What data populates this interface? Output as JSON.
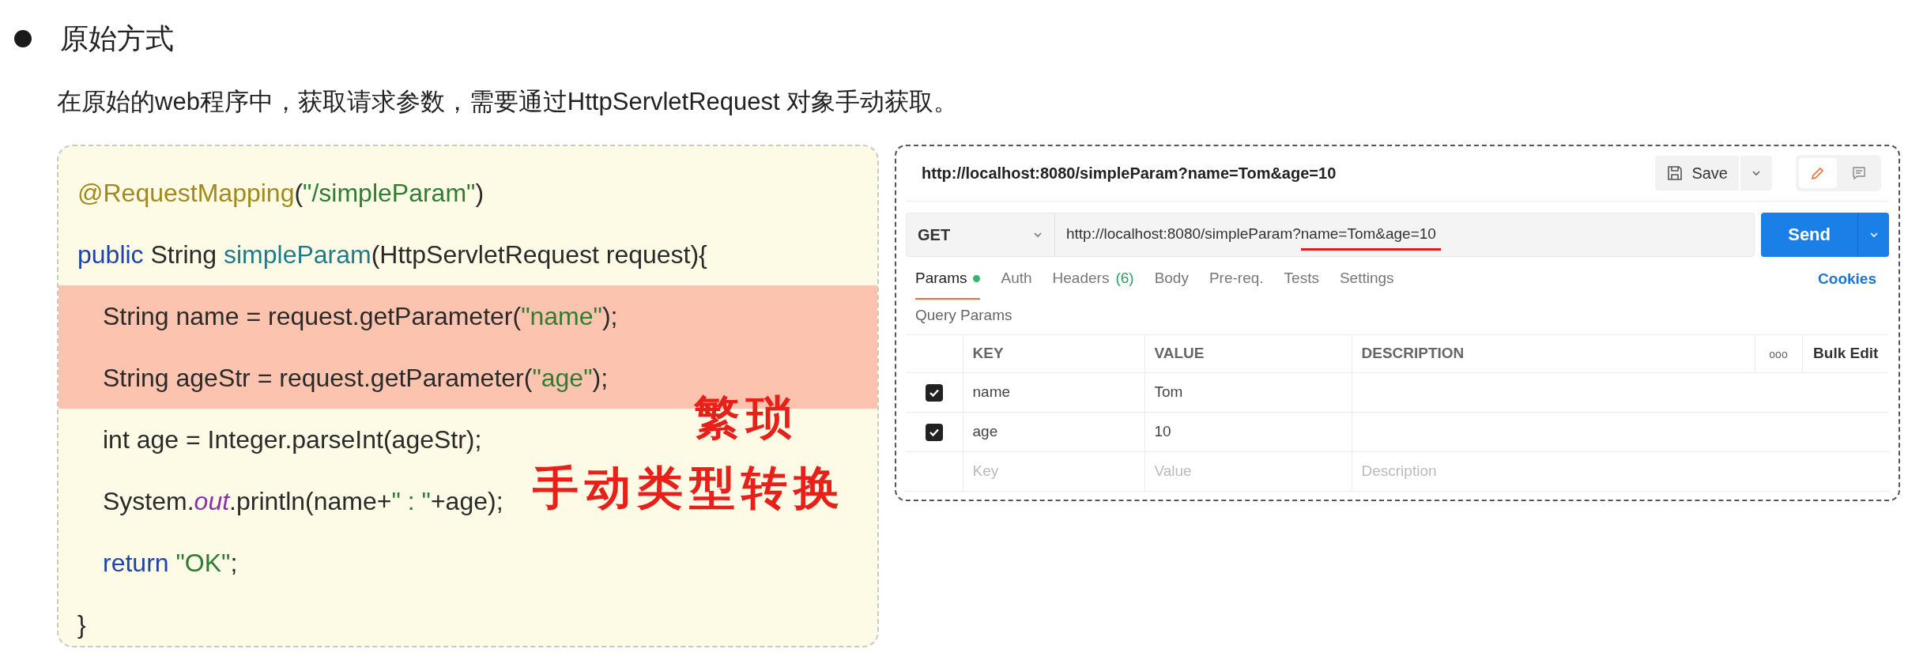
{
  "heading": {
    "text": "原始方式"
  },
  "description": "在原始的web程序中，获取请求参数，需要通过HttpServletRequest 对象手动获取。",
  "code": {
    "lines": [
      {
        "highlighted": false,
        "tokens": [
          {
            "kind": "annotation",
            "text": "@RequestMapping"
          },
          {
            "kind": "plain",
            "text": "("
          },
          {
            "kind": "string",
            "text": "\"/simpleParam\""
          },
          {
            "kind": "plain",
            "text": ")"
          }
        ]
      },
      {
        "highlighted": false,
        "tokens": [
          {
            "kind": "keyword",
            "text": "public"
          },
          {
            "kind": "plain",
            "text": " String "
          },
          {
            "kind": "method",
            "text": "simpleParam"
          },
          {
            "kind": "plain",
            "text": "(HttpServletRequest request){"
          }
        ],
        "children": [
          {
            "highlighted": true,
            "tokens": [
              {
                "kind": "plain",
                "text": "String name = request.getParameter("
              },
              {
                "kind": "string",
                "text": "\"name\""
              },
              {
                "kind": "plain",
                "text": ");"
              }
            ]
          },
          {
            "highlighted": true,
            "tokens": [
              {
                "kind": "plain",
                "text": "String ageStr = request.getParameter("
              },
              {
                "kind": "string",
                "text": "\"age\""
              },
              {
                "kind": "plain",
                "text": ");"
              }
            ]
          },
          {
            "highlighted": false,
            "tokens": [
              {
                "kind": "plain",
                "text": "int age = Integer.parseInt(ageStr);"
              }
            ]
          },
          {
            "highlighted": false,
            "tokens": [
              {
                "kind": "plain",
                "text": "System."
              },
              {
                "kind": "field",
                "text": "out"
              },
              {
                "kind": "plain",
                "text": ".println(name+"
              },
              {
                "kind": "string",
                "text": "\" : \""
              },
              {
                "kind": "plain",
                "text": "+age);"
              }
            ]
          },
          {
            "highlighted": false,
            "tokens": [
              {
                "kind": "keyword",
                "text": "return "
              },
              {
                "kind": "string",
                "text": "\"OK\""
              },
              {
                "kind": "plain",
                "text": ";"
              }
            ]
          }
        ]
      },
      {
        "highlighted": false,
        "tokens": [
          {
            "kind": "plain",
            "text": "}"
          }
        ]
      }
    ]
  },
  "annotations": [
    "繁琐",
    "手动类型转换"
  ],
  "request": {
    "title": "http://localhost:8080/simpleParam?name=Tom&age=10",
    "save": "Save",
    "method": "GET",
    "url_base": "http://localhost:8080/simpleParam?",
    "url_query": "name=Tom&age=10",
    "send": "Send",
    "tabs": [
      {
        "label": "Params",
        "selected": true,
        "active_dot": true
      },
      {
        "label": "Auth",
        "selected": false,
        "active_dot": false
      },
      {
        "label": "Headers",
        "count": "(6)",
        "selected": false,
        "active_dot": false
      },
      {
        "label": "Body",
        "selected": false,
        "active_dot": false
      },
      {
        "label": "Pre-req.",
        "selected": false,
        "active_dot": false
      },
      {
        "label": "Tests",
        "selected": false,
        "active_dot": false
      },
      {
        "label": "Settings",
        "selected": false,
        "active_dot": false
      }
    ],
    "cookies": "Cookies",
    "section": "Query Params",
    "columns": [
      "KEY",
      "VALUE",
      "DESCRIPTION"
    ],
    "more": "ooo",
    "bulk_edit": "Bulk Edit",
    "rows": [
      {
        "key": "name",
        "value": "Tom",
        "checked": true
      },
      {
        "key": "age",
        "value": "10",
        "checked": true
      }
    ],
    "new_row": {
      "key_placeholder": "Key",
      "value_placeholder": "Value",
      "description_placeholder": "Description"
    },
    "view_modes": [
      {
        "kind": "edit",
        "selected": true
      },
      {
        "kind": "comment",
        "selected": false
      }
    ]
  }
}
